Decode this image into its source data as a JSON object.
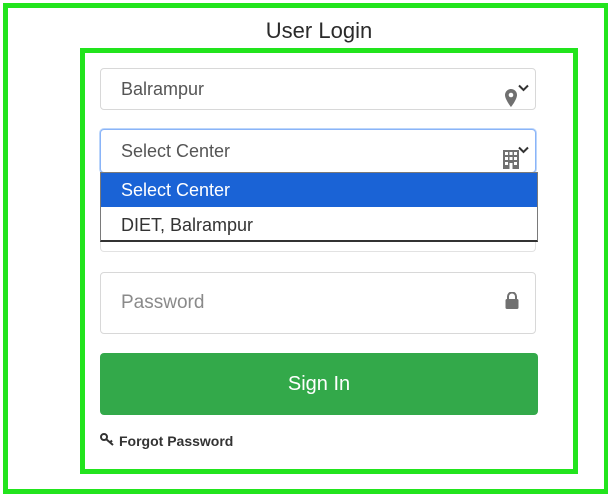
{
  "page_title": "User Login",
  "district_select": {
    "value": "Balrampur",
    "icon": "map-pin-icon"
  },
  "center_select": {
    "value": "Select Center",
    "icon": "building-icon",
    "options": [
      {
        "label": "Select Center",
        "selected": true
      },
      {
        "label": "DIET, Balrampur",
        "selected": false
      }
    ]
  },
  "password_field": {
    "placeholder": "Password",
    "icon": "lock-icon"
  },
  "signin_button": {
    "label": "Sign In",
    "color": "#33a94a"
  },
  "forgot_password": {
    "label": "Forgot Password",
    "icon": "key-icon"
  },
  "colors": {
    "frame_green": "#22e41d",
    "option_highlight": "#1a63d6"
  }
}
